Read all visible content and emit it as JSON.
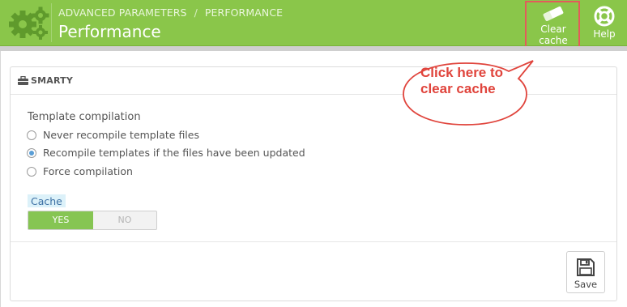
{
  "header": {
    "breadcrumb": [
      "ADVANCED PARAMETERS",
      "PERFORMANCE"
    ],
    "breadcrumb_separator": "/",
    "title": "Performance",
    "toolbar": {
      "clear_cache_label": "Clear cache",
      "help_label": "Help"
    }
  },
  "annotation": {
    "callout_line1": "Click here to",
    "callout_line2": "clear cache"
  },
  "smarty_panel": {
    "title": "SMARTY",
    "template_compilation": {
      "label": "Template compilation",
      "options": [
        {
          "label": "Never recompile template files",
          "selected": false
        },
        {
          "label": "Recompile templates if the files have been updated",
          "selected": true
        },
        {
          "label": "Force compilation",
          "selected": false
        }
      ]
    },
    "cache": {
      "label": "Cache",
      "yes_label": "YES",
      "no_label": "NO",
      "value": "YES"
    },
    "save_label": "Save"
  },
  "colors": {
    "header_green": "#8ac64a",
    "toggle_green": "#86c553",
    "callout_red": "#e0443c",
    "highlight_red": "#e35b5b"
  },
  "icons": [
    "gears-icon",
    "eraser-icon",
    "help-lifebuoy-icon",
    "briefcase-icon",
    "save-icon"
  ]
}
